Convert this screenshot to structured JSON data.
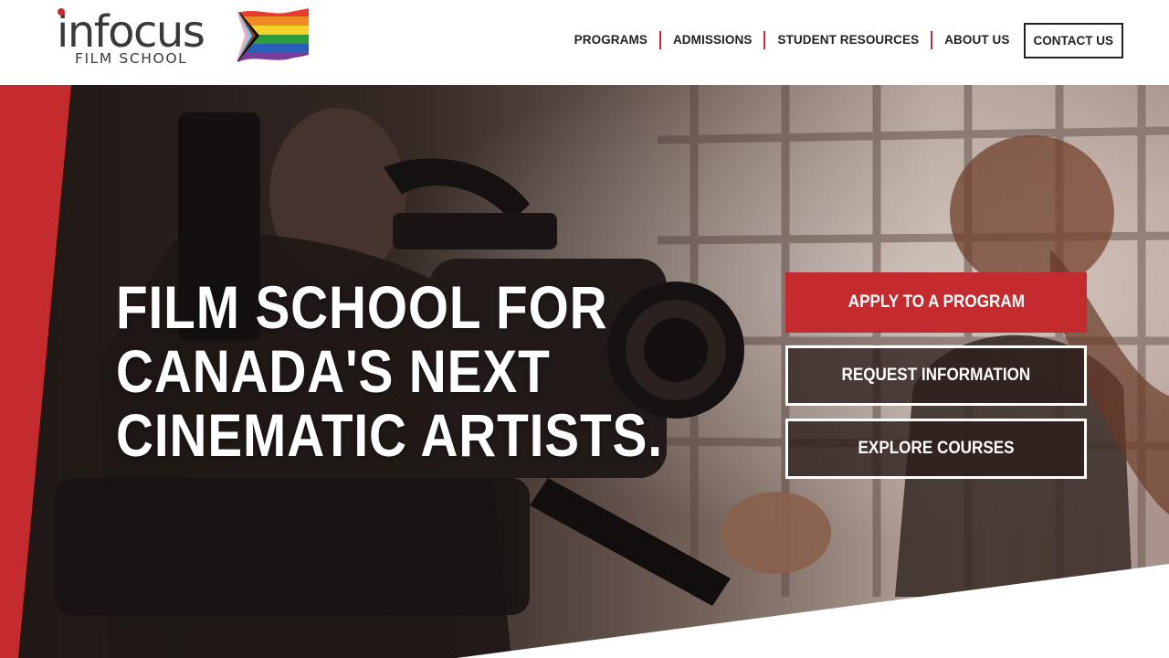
{
  "brand": {
    "wordmark": "infocus",
    "subtitle": "FILM SCHOOL",
    "accent_color": "#c42b2f",
    "flag_icon": "progress-pride-flag-icon"
  },
  "nav": {
    "items": [
      {
        "label": "PROGRAMS"
      },
      {
        "label": "ADMISSIONS"
      },
      {
        "label": "STUDENT RESOURCES"
      },
      {
        "label": "ABOUT US"
      }
    ],
    "contact_label": "CONTACT US",
    "separator_color": "#c42b2f"
  },
  "hero": {
    "headline_lines": [
      "FILM SCHOOL FOR",
      "CANADA'S NEXT",
      "CINEMATIC ARTISTS."
    ],
    "buttons": {
      "apply": "APPLY TO A PROGRAM",
      "request": "REQUEST INFORMATION",
      "explore": "EXPLORE COURSES"
    },
    "background_icon": "camera-operator-photo"
  }
}
